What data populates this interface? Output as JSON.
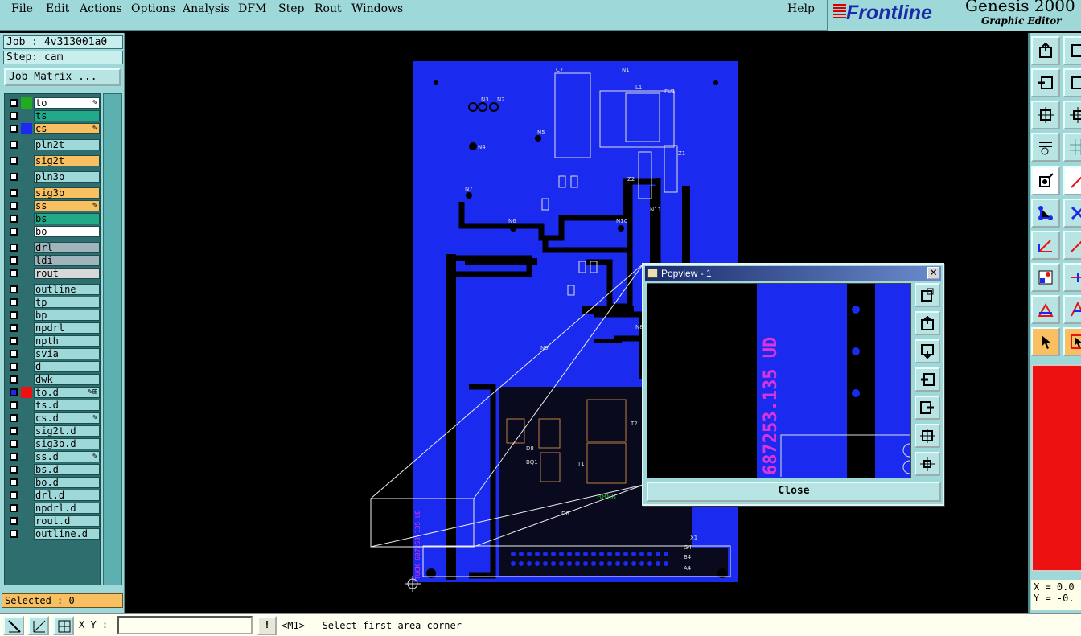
{
  "menubar": {
    "items": [
      "File",
      "Edit",
      "Actions",
      "Options",
      "Analysis",
      "DFM",
      "Step",
      "Rout",
      "Windows"
    ],
    "help": "Help"
  },
  "brand": {
    "logo": "Frontline",
    "product": "Genesis 2000",
    "subtitle": "Graphic Editor"
  },
  "job": {
    "job_label": "Job : 4v313001a0",
    "step_label": "Step: cam",
    "job_matrix": "Job Matrix ..."
  },
  "layers": [
    {
      "name": "to",
      "swatch": "#22aa22",
      "bg": "#ffffff",
      "mark": "✎"
    },
    {
      "name": "ts",
      "swatch": "#2e6e6e",
      "bg": "#22aa88",
      "mark": ""
    },
    {
      "name": "cs",
      "swatch": "#1a2aee",
      "bg": "#f8c060",
      "mark": "✎"
    },
    {
      "name": "pln2t",
      "swatch": "",
      "bg": "#9fd8d8",
      "mark": ""
    },
    {
      "name": "sig2t",
      "swatch": "",
      "bg": "#f8c060",
      "mark": ""
    },
    {
      "name": "pln3b",
      "swatch": "",
      "bg": "#9fd8d8",
      "mark": ""
    },
    {
      "name": "sig3b",
      "swatch": "",
      "bg": "#f8c060",
      "mark": ""
    },
    {
      "name": "ss",
      "swatch": "",
      "bg": "#f8c060",
      "mark": "✎"
    },
    {
      "name": "bs",
      "swatch": "",
      "bg": "#22aa88",
      "mark": ""
    },
    {
      "name": "bo",
      "swatch": "",
      "bg": "#ffffff",
      "mark": ""
    },
    {
      "name": "drl",
      "swatch": "",
      "bg": "#a0b4bc",
      "mark": ""
    },
    {
      "name": "ldi",
      "swatch": "",
      "bg": "#a0b4bc",
      "mark": ""
    },
    {
      "name": "rout",
      "swatch": "",
      "bg": "#d8d8d8",
      "mark": ""
    },
    {
      "name": "outline",
      "swatch": "",
      "bg": "#9fd8d8",
      "mark": ""
    },
    {
      "name": "tp",
      "swatch": "",
      "bg": "#9fd8d8",
      "mark": ""
    },
    {
      "name": "bp",
      "swatch": "",
      "bg": "#9fd8d8",
      "mark": ""
    },
    {
      "name": "npdrl",
      "swatch": "",
      "bg": "#9fd8d8",
      "mark": ""
    },
    {
      "name": "npth",
      "swatch": "",
      "bg": "#9fd8d8",
      "mark": ""
    },
    {
      "name": "svia",
      "swatch": "",
      "bg": "#9fd8d8",
      "mark": ""
    },
    {
      "name": "d",
      "swatch": "",
      "bg": "#9fd8d8",
      "mark": ""
    },
    {
      "name": "dwk",
      "swatch": "",
      "bg": "#9fd8d8",
      "mark": ""
    },
    {
      "name": "to.d",
      "swatch": "#ee1111",
      "bg": "#9fd8d8",
      "mark": "✎⊞"
    },
    {
      "name": "ts.d",
      "swatch": "",
      "bg": "#9fd8d8",
      "mark": ""
    },
    {
      "name": "cs.d",
      "swatch": "",
      "bg": "#9fd8d8",
      "mark": "✎"
    },
    {
      "name": "sig2t.d",
      "swatch": "",
      "bg": "#9fd8d8",
      "mark": ""
    },
    {
      "name": "sig3b.d",
      "swatch": "",
      "bg": "#9fd8d8",
      "mark": ""
    },
    {
      "name": "ss.d",
      "swatch": "",
      "bg": "#9fd8d8",
      "mark": "✎"
    },
    {
      "name": "bs.d",
      "swatch": "",
      "bg": "#9fd8d8",
      "mark": ""
    },
    {
      "name": "bo.d",
      "swatch": "",
      "bg": "#9fd8d8",
      "mark": ""
    },
    {
      "name": "drl.d",
      "swatch": "",
      "bg": "#9fd8d8",
      "mark": ""
    },
    {
      "name": "npdrl.d",
      "swatch": "",
      "bg": "#9fd8d8",
      "mark": ""
    },
    {
      "name": "rout.d",
      "swatch": "",
      "bg": "#9fd8d8",
      "mark": ""
    },
    {
      "name": "outline.d",
      "swatch": "",
      "bg": "#9fd8d8",
      "mark": ""
    }
  ],
  "selected": "Selected : 0",
  "pcb": {
    "refdes": [
      "C7",
      "N1",
      "L1",
      "FU1",
      "N3",
      "N2",
      "N5",
      "N4",
      "Z1",
      "Z2",
      "N7",
      "N6",
      "N10",
      "N11",
      "N9",
      "N8",
      "D8",
      "BQ1",
      "T1",
      "T2",
      "D6",
      "X1",
      "G4",
      "B4",
      "A4"
    ],
    "silk_text": "TUCK 687253.135 UD",
    "code": "8888"
  },
  "popview": {
    "title": "Popview - 1",
    "close_x": "✕",
    "zoom_text": "687253.135 UD",
    "close": "Close"
  },
  "coords": {
    "x": "X = 0.0",
    "y": "Y = -0."
  },
  "status": {
    "xy_label": "X Y :",
    "xy_value": "",
    "warn": "!",
    "prompt": "<M1> - Select first area corner"
  },
  "colors": {
    "panel": "#9fd8d8",
    "board": "#1a2aee",
    "highlight": "#f8c060",
    "silk_magenta": "#dd33dd"
  }
}
